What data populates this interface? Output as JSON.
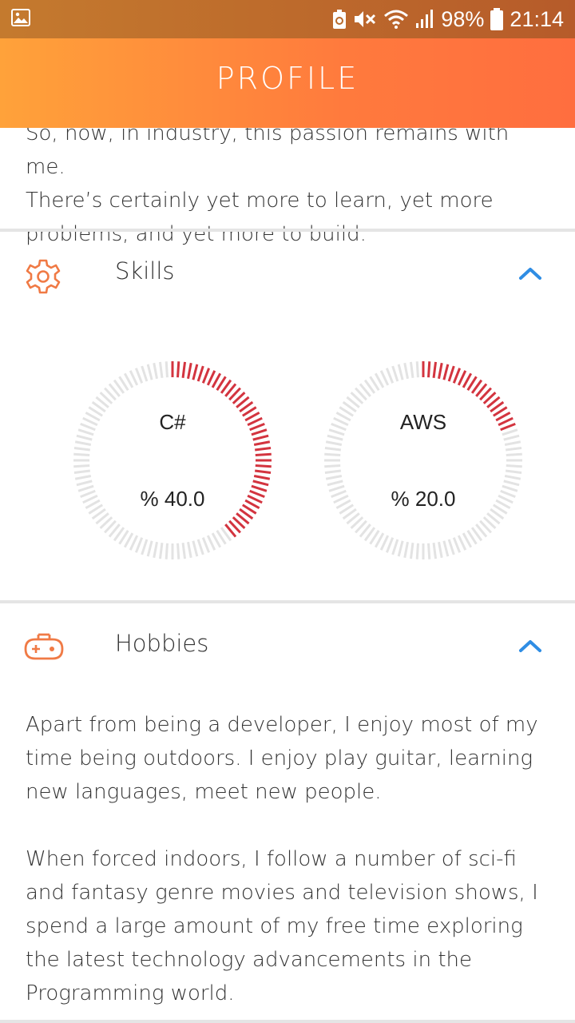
{
  "status_bar": {
    "battery_percent": "98%",
    "time": "21:14"
  },
  "app_bar": {
    "title": "PROFILE"
  },
  "about": {
    "text_lines": [
      "So, now, in industry, this passion remains with me.",
      "There’s certainly yet more to learn, yet more",
      "problems, and yet more to build."
    ]
  },
  "skills": {
    "title": "Skills",
    "icon": "gear-icon",
    "items": [
      {
        "name": "C#",
        "percent_label": "% 40.0",
        "value": 0.4
      },
      {
        "name": "AWS",
        "percent_label": "% 20.0",
        "value": 0.2
      }
    ]
  },
  "hobbies": {
    "title": "Hobbies",
    "icon": "gamepad-icon",
    "paragraph1_lines": [
      "Apart from being a developer, I enjoy most of my",
      "time being outdoors. I enjoy play guitar, learning",
      "new languages, meet new people."
    ],
    "paragraph2_lines": [
      "When forced indoors, I follow a number of sci-fi",
      "and fantasy genre movies and television shows, I",
      "spend a large amount of my free time exploring",
      "the latest technology advancements in the",
      "Programming world."
    ]
  },
  "colors": {
    "accent_orange": "#f07a45",
    "chevron_blue": "#2f8de4",
    "gauge_red": "#d3343f",
    "gauge_grey": "#e3e3e3",
    "appbar_start": "#ffa23a",
    "appbar_end": "#ff6e3f"
  }
}
